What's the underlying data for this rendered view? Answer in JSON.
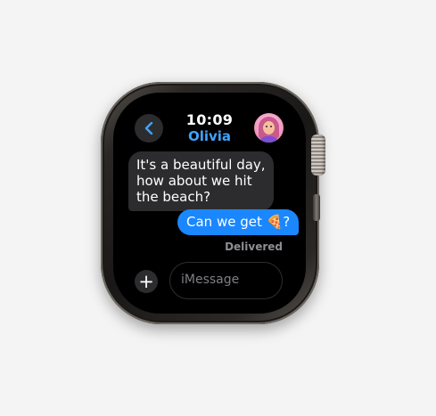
{
  "header": {
    "time": "10:09",
    "contact_name": "Olivia"
  },
  "messages": [
    {
      "direction": "incoming",
      "text": "It's a beautiful day,\nhow about we hit\nthe beach?"
    },
    {
      "direction": "outgoing",
      "text": "Can we get 🍕?"
    }
  ],
  "status": {
    "delivered": "Delivered"
  },
  "composer": {
    "add_label": "+",
    "placeholder": "iMessage"
  },
  "icons": {
    "back": "chevron-left-icon",
    "avatar": "memoji-avatar",
    "add": "plus-icon"
  },
  "colors": {
    "accent": "#3fa3ff",
    "outgoing_bubble": "#1a87ff",
    "incoming_bubble": "#2c2c2e",
    "screen": "#000000",
    "background": "#f4f4f4"
  }
}
